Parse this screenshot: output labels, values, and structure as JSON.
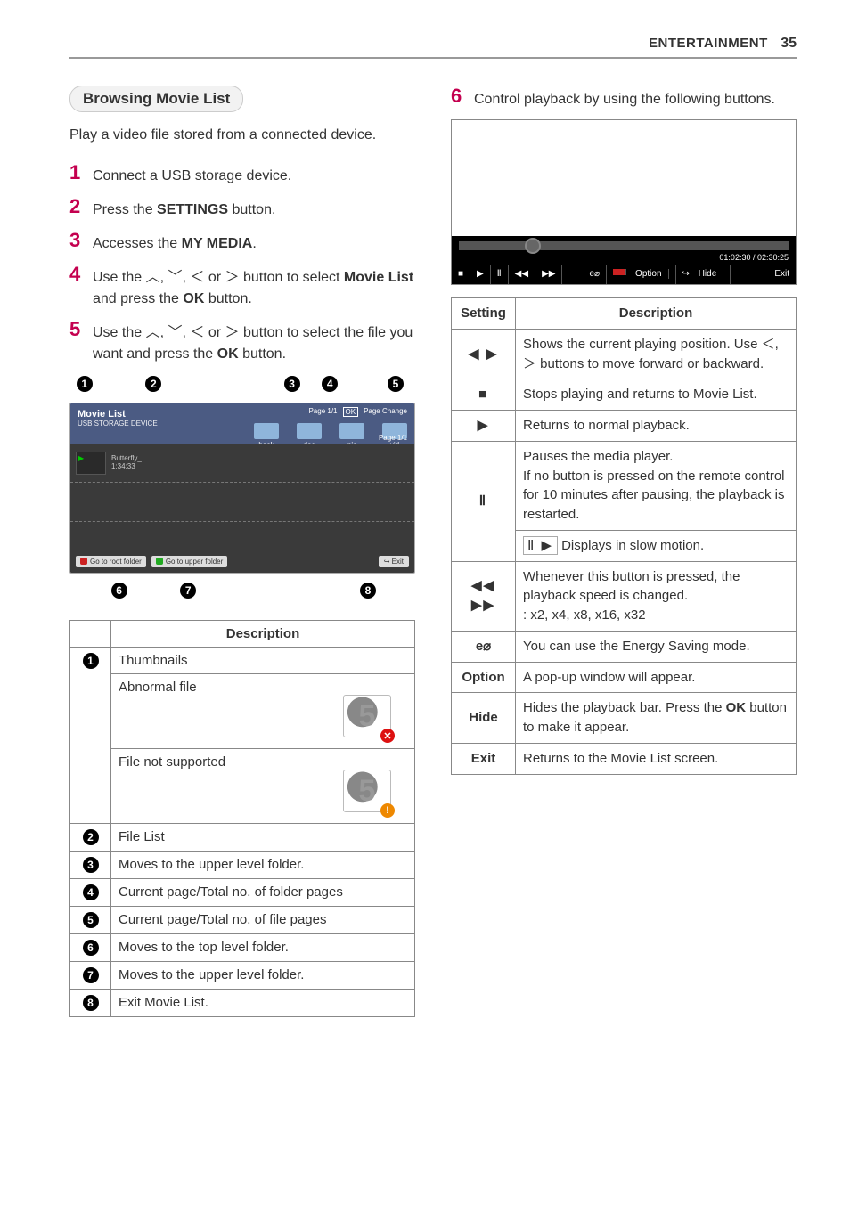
{
  "header": {
    "section": "ENTERTAINMENT",
    "page": "35"
  },
  "heading": "Browsing Movie List",
  "intro": "Play a video file stored from a connected device.",
  "steps": {
    "s1": "Connect a USB storage device.",
    "s2a": "Press the ",
    "s2b": "SETTINGS",
    "s2c": " button.",
    "s3a": "Accesses the ",
    "s3b": "MY MEDIA",
    "s3c": ".",
    "s4a": "Use the ",
    "s4nav": "︿, ﹀, ＜ or ＞",
    "s4b": " button to select ",
    "s4c": "Movie List",
    "s4d": " and press the ",
    "s4e": "OK",
    "s4f": " button.",
    "s5a": "Use the ",
    "s5nav": "︿, ﹀, ＜ or ＞",
    "s5b": " button to select the file you want and press the ",
    "s5c": "OK",
    "s5d": " button.",
    "s6": "Control playback by using the following buttons."
  },
  "movielist_fig": {
    "title": "Movie List",
    "sub": "USB STORAGE DEVICE",
    "icons": {
      "i1": "book",
      "i2": "doc",
      "i3": "pic",
      "i4": "vid"
    },
    "pages_top": "Page 1/1",
    "ok": "OK",
    "page_ch": "Page Change",
    "pages_right": "Page 1/1",
    "file": {
      "name": "Butterfly_...",
      "dur": "1:34:33"
    },
    "btn_root": "Go to root folder",
    "btn_upper": "Go to upper folder",
    "exit": "Exit"
  },
  "desc_table": {
    "header": "Description",
    "rows": {
      "r1": "Thumbnails",
      "r1a": "Abnormal file",
      "r1b": "File not supported",
      "r2": "File List",
      "r3": "Moves to the upper level folder.",
      "r4": "Current page/Total no. of folder pages",
      "r5": "Current page/Total no. of file pages",
      "r6": "Moves to the top level folder.",
      "r7": "Moves to the upper level folder.",
      "r8": "Exit Movie List."
    }
  },
  "playback_fig": {
    "time": "01:02:30 / 02:30:25",
    "lbl_option": "Option",
    "lbl_hide": "Hide",
    "lbl_exit": "Exit"
  },
  "settings_table": {
    "h1": "Setting",
    "h2": "Description",
    "seek_icon": "◀ ▶",
    "seek_a": "Shows the current playing position. Use ",
    "seek_nav": "＜, ＞",
    "seek_b": " buttons to move forward or backward.",
    "stop_icon": "■",
    "stop": "Stops playing and returns to Movie List.",
    "play_icon": "▶",
    "play": "Returns to normal playback.",
    "pause_icon": "Ⅱ",
    "pause_a": "Pauses the media player.",
    "pause_b": "If no button is pressed on the remote control for 10 minutes after pausing, the playback is restarted.",
    "slow_icon": "Ⅱ ▶",
    "slow": "Displays in slow motion.",
    "skip_icon": "◀◀ ▶▶",
    "skip_a": "Whenever this button is pressed, the playback speed is changed.",
    "skip_b": ": x2, x4, x8, x16, x32",
    "energy_icon": "e⌀",
    "energy": "You can use the Energy Saving mode.",
    "option_lbl": "Option",
    "option": "A pop-up window will appear.",
    "hide_lbl": "Hide",
    "hide_a": "Hides the playback bar. Press the ",
    "hide_b": "OK",
    "hide_c": " button to make it appear.",
    "exit_lbl": "Exit",
    "exit": "Returns to the Movie List screen."
  }
}
